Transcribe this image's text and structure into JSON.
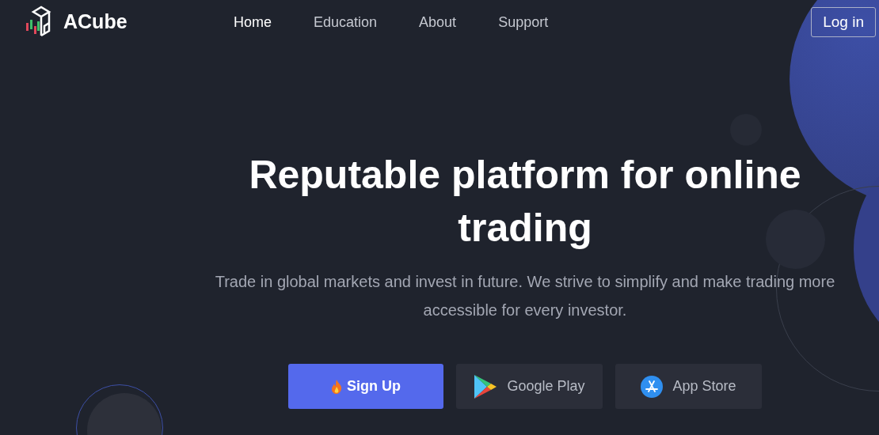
{
  "brand": {
    "name": "ACube"
  },
  "nav": [
    {
      "label": "Home",
      "selected": true
    },
    {
      "label": "Education",
      "selected": false
    },
    {
      "label": "About",
      "selected": false
    },
    {
      "label": "Support",
      "selected": false
    }
  ],
  "login": {
    "label": "Log in"
  },
  "hero": {
    "title": "Reputable platform for online trading",
    "subtitle": "Trade in global markets and invest in future. We strive to simplify and make trading more accessible for every investor."
  },
  "actions": [
    {
      "kind": "signup",
      "label": "Sign Up"
    },
    {
      "kind": "google",
      "label": "Google Play"
    },
    {
      "kind": "apple",
      "label": "App Store"
    }
  ]
}
